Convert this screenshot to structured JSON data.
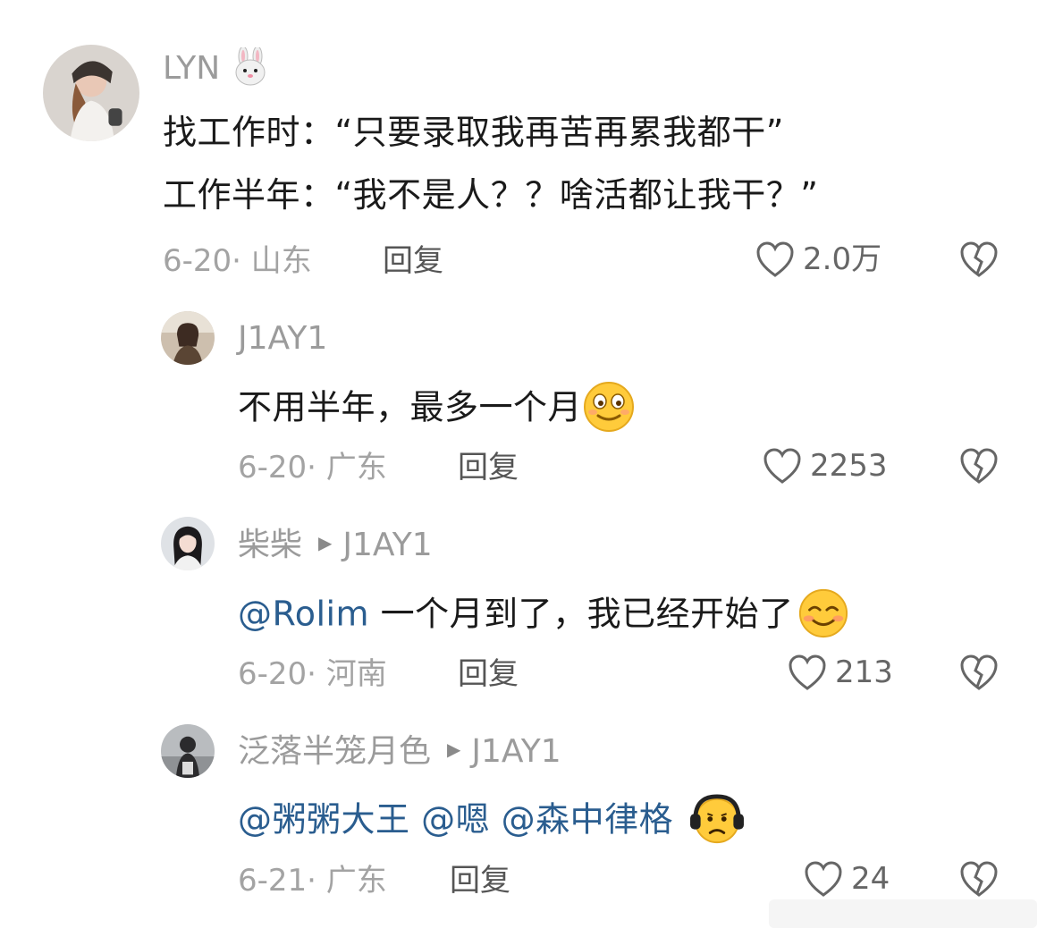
{
  "colors": {
    "mention": "#2a5d8f",
    "meta": "#a3a3a3",
    "name": "#9b9b9b"
  },
  "comments": [
    {
      "username": "LYN",
      "username_emoji": "rabbit-face",
      "lines": [
        "找工作时：“只要录取我再苦再累我都干”",
        "工作半年：“我不是人？？啥活都让我干？”"
      ],
      "date_location": "6-20· 山东",
      "reply_label": "回复",
      "likes": "2.0万"
    },
    {
      "username": "J1AY1",
      "text": "不用半年，最多一个月",
      "emoji": "smirk-face",
      "date_location": "6-20· 广东",
      "reply_label": "回复",
      "likes": "2253"
    },
    {
      "username": "柴柴",
      "reply_to": "J1AY1",
      "mention": "@Rolim",
      "text": " 一个月到了，我已经开始了",
      "emoji": "smiling-face",
      "date_location": "6-20· 河南",
      "reply_label": "回复",
      "likes": "213"
    },
    {
      "username": "泛落半笼月色",
      "reply_to": "J1AY1",
      "mentions": "@粥粥大王 @嗯 @森中律格",
      "emoji": "headphones-face",
      "date_location": "6-21· 广东",
      "reply_label": "回复",
      "likes": "24"
    }
  ]
}
